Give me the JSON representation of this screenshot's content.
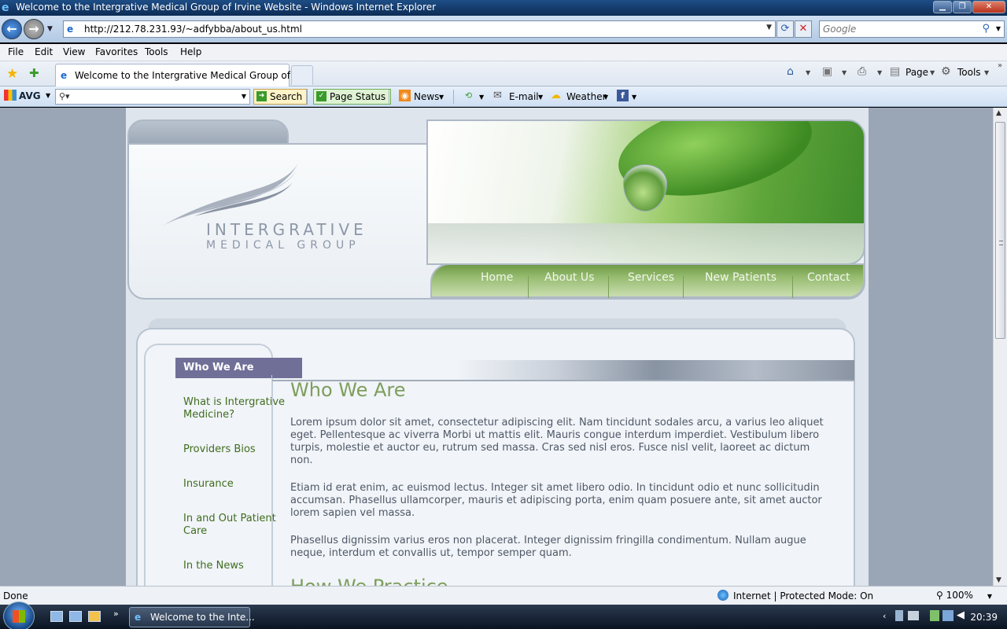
{
  "window": {
    "title": "Welcome to the Intergrative Medical Group of Irvine Website - Windows Internet Explorer",
    "minimize": "▁",
    "maximize": "❐",
    "close": "✕"
  },
  "address_bar": {
    "url": "http://212.78.231.93/~adfybba/about_us.html",
    "search_placeholder": "Google"
  },
  "menu": [
    "File",
    "Edit",
    "View",
    "Favorites",
    "Tools",
    "Help"
  ],
  "tab": {
    "active_label": "Welcome to the Intergrative Medical Group of Irv..."
  },
  "command_bar": {
    "page_label": "Page",
    "tools_label": "Tools"
  },
  "avg_toolbar": {
    "logo": "AVG",
    "search_label": "Search",
    "page_status_label": "Page Status",
    "news_label": "News",
    "email_label": "E-mail",
    "weather_label": "Weather"
  },
  "site": {
    "logo_line1": "INTERGRATIVE",
    "logo_line2": "MEDICAL GROUP",
    "nav": [
      "Home",
      "About Us",
      "Services",
      "New Patients",
      "Contact"
    ],
    "sidebar": {
      "active": "Who We Are",
      "items": [
        "What is Intergrative Medicine?",
        "Providers Bios",
        "Insurance",
        "In and Out Patient Care",
        "In the News"
      ]
    },
    "main": {
      "title": "Who We Are",
      "paragraphs": [
        "Lorem ipsum dolor sit amet, consectetur adipiscing elit. Nam tincidunt sodales arcu, a varius leo aliquet eget. Pellentesque ac viverra Morbi ut mattis elit. Mauris congue interdum imperdiet. Vestibulum libero turpis, molestie et auctor eu, rutrum sed massa. Cras sed nisl eros. Fusce nisl velit, laoreet ac dictum non.",
        "Etiam id erat enim, ac euismod lectus. Integer sit amet libero odio. In tincidunt odio et nunc sollicitudin accumsan. Phasellus ullamcorper, mauris et adipiscing porta, enim quam posuere ante, sit amet auctor lorem sapien vel massa.",
        "Phasellus dignissim varius eros non placerat. Integer dignissim fringilla condimentum. Nullam augue neque, interdum et convallis ut, tempor semper quam."
      ],
      "subtitle": "How We Practice"
    }
  },
  "status_bar": {
    "status": "Done",
    "zone": "Internet | Protected Mode: On",
    "zoom": "100%"
  },
  "taskbar": {
    "ie_task": "Welcome to the Inte...",
    "clock": "20:39"
  }
}
